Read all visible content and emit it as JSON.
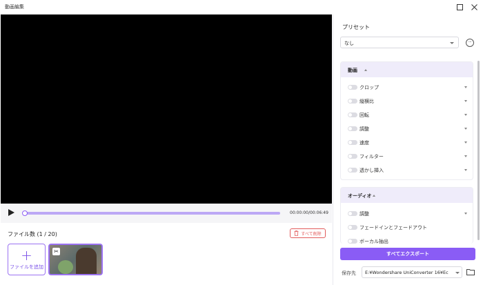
{
  "window": {
    "title": "動画編集"
  },
  "player": {
    "time_display": "00:00:00/00:06:49",
    "progress": 0
  },
  "files": {
    "count_label": "ファイル数 (1 / 20)",
    "delete_all_label": "すべて削除",
    "add_file_label": "ファイルを追加"
  },
  "preset": {
    "label": "プリセット",
    "value": "なし"
  },
  "video_section": {
    "title": "動画",
    "items": [
      {
        "label": "クロップ"
      },
      {
        "label": "縦横比"
      },
      {
        "label": "回転"
      },
      {
        "label": "調整"
      },
      {
        "label": "速度"
      },
      {
        "label": "フィルター"
      },
      {
        "label": "透かし挿入"
      }
    ]
  },
  "audio_section": {
    "title": "オーディオ",
    "items": [
      {
        "label": "調整"
      },
      {
        "label": "フェードインとフェードアウト"
      },
      {
        "label": "ボーカル抽出"
      }
    ]
  },
  "export": {
    "button_label": "すべてエクスポート",
    "save_label": "保存先",
    "save_path": "E:¥Wondershare UniConverter 16¥Ec"
  },
  "colors": {
    "accent": "#8a5cf5",
    "danger": "#e25b5b",
    "section_header": "#efecfa"
  },
  "icons": [
    "close-icon",
    "maximize-icon",
    "play-icon",
    "trash-icon",
    "plus-icon",
    "scissors-icon",
    "more-icon",
    "folder-icon",
    "chevron-up-icon",
    "chevron-down-icon"
  ]
}
